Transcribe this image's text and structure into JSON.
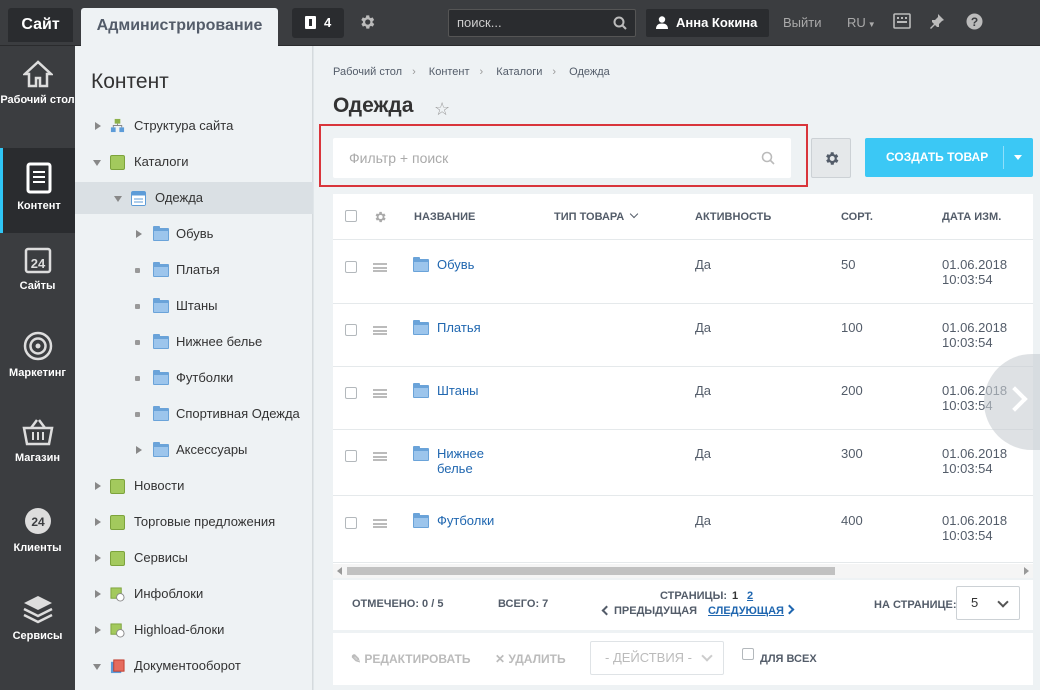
{
  "topbar": {
    "site_tab": "Сайт",
    "admin_tab": "Администрирование",
    "notifications_count": "4",
    "search_placeholder": "поиск...",
    "user_name": "Анна Кокина",
    "logout": "Выйти",
    "lang": "RU"
  },
  "rail": [
    {
      "label": "Рабочий стол",
      "icon": "home-icon"
    },
    {
      "label": "Контент",
      "icon": "document-icon"
    },
    {
      "label": "Сайты",
      "icon": "calendar-24-icon"
    },
    {
      "label": "Маркетинг",
      "icon": "target-icon"
    },
    {
      "label": "Магазин",
      "icon": "basket-icon"
    },
    {
      "label": "Клиенты",
      "icon": "clients-24-icon"
    },
    {
      "label": "Сервисы",
      "icon": "layers-icon"
    }
  ],
  "tree": {
    "title": "Контент",
    "items": [
      {
        "label": "Структура сайта"
      },
      {
        "label": "Каталоги"
      },
      {
        "label": "Одежда"
      },
      {
        "label": "Обувь"
      },
      {
        "label": "Платья"
      },
      {
        "label": "Штаны"
      },
      {
        "label": "Нижнее белье"
      },
      {
        "label": "Футболки"
      },
      {
        "label": "Спортивная Одежда"
      },
      {
        "label": "Аксессуары"
      },
      {
        "label": "Новости"
      },
      {
        "label": "Торговые предложения"
      },
      {
        "label": "Сервисы"
      },
      {
        "label": "Инфоблоки"
      },
      {
        "label": "Highload-блоки"
      },
      {
        "label": "Документооборот"
      }
    ]
  },
  "breadcrumbs": [
    "Рабочий стол",
    "Контент",
    "Каталоги",
    "Одежда"
  ],
  "page_title": "Одежда",
  "filter": {
    "placeholder": "Фильтр + поиск"
  },
  "create_button": "СОЗДАТЬ ТОВАР",
  "grid": {
    "columns": {
      "name": "НАЗВАНИЕ",
      "type": "ТИП ТОВАРА",
      "active": "АКТИВНОСТЬ",
      "sort": "СОРТ.",
      "date": "ДАТА ИЗМ."
    },
    "rows": [
      {
        "name": "Обувь",
        "name2": "",
        "active": "Да",
        "sort": "50",
        "date": "01.06.2018",
        "time": "10:03:54"
      },
      {
        "name": "Платья",
        "name2": "",
        "active": "Да",
        "sort": "100",
        "date": "01.06.2018",
        "time": "10:03:54"
      },
      {
        "name": "Штаны",
        "name2": "",
        "active": "Да",
        "sort": "200",
        "date": "01.06.2018",
        "time": "10:03:54"
      },
      {
        "name": "Нижнее",
        "name2": "белье",
        "active": "Да",
        "sort": "300",
        "date": "01.06.2018",
        "time": "10:03:54"
      },
      {
        "name": "Футболки",
        "name2": "",
        "active": "Да",
        "sort": "400",
        "date": "01.06.2018",
        "time": "10:03:54"
      }
    ]
  },
  "footer": {
    "selected": "ОТМЕЧЕНО: 0 / 5",
    "total": "ВСЕГО: 7",
    "pages_label": "СТРАНИЦЫ:",
    "page1": "1",
    "page2": "2",
    "prev": "ПРЕДЫДУЩАЯ",
    "next": "СЛЕДУЮЩАЯ",
    "per_page_label": "НА СТРАНИЦЕ:",
    "per_page": "5"
  },
  "actions": {
    "edit": "РЕДАКТИРОВАТЬ",
    "delete": "УДАЛИТЬ",
    "actions_select": "- ДЕЙСТВИЯ -",
    "for_all": "ДЛЯ ВСЕХ"
  }
}
